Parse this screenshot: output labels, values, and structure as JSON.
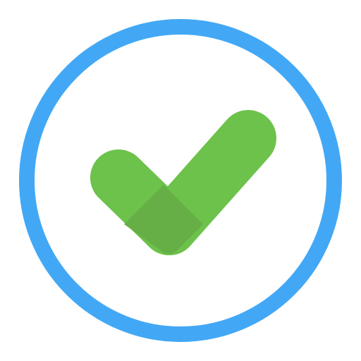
{
  "icon": {
    "name": "check-circle-icon",
    "colors": {
      "ring": "#42A8F5",
      "background": "#FFFFFF",
      "check": "#6CC24A",
      "check_overlap": "#66AF47"
    }
  }
}
